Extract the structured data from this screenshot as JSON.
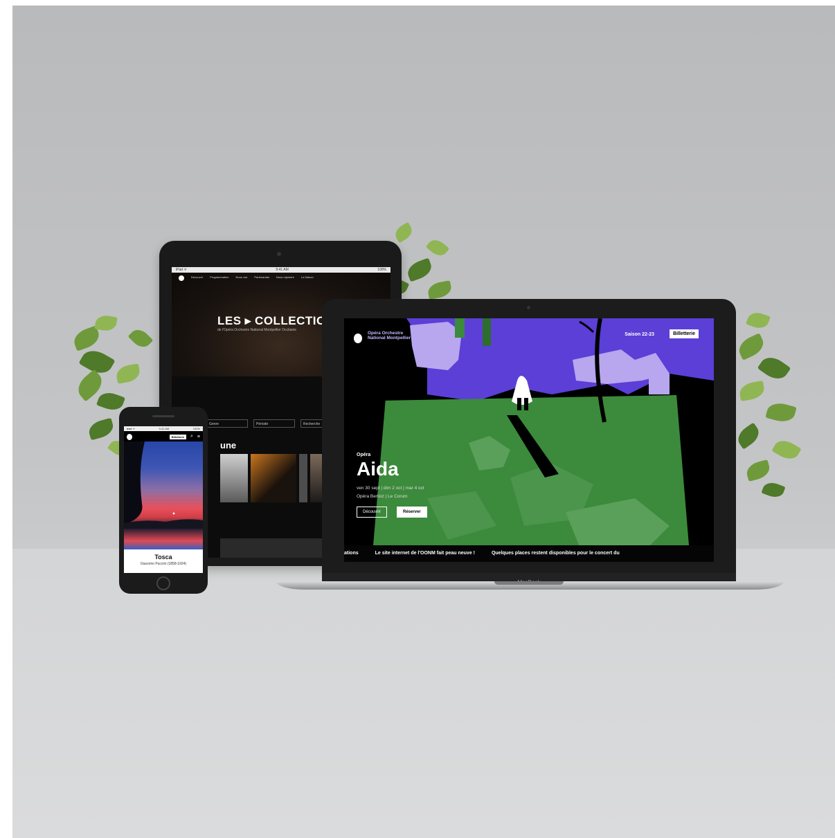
{
  "tablet": {
    "status_left": "iPad ᯤ",
    "status_time": "9:41 AM",
    "status_right": "100%",
    "nav_items": [
      "Découvrir",
      "Programmation",
      "Nous voir",
      "Partenariats",
      "Nous rejoindre",
      "La Saison"
    ],
    "hero_title": "LES ▸ COLLECTION",
    "hero_subtitle": "de l'Opéra Orchestre National Montpellier Occitanie",
    "filters": [
      "Genre",
      "Période",
      "Recherche"
    ],
    "section_title": "une"
  },
  "laptop": {
    "brand_name": "Opéra Orchestre National Montpellier",
    "season": "Saison 22-23",
    "tickets_button": "Billetterie",
    "category": "Opéra",
    "title": "Aida",
    "dates": "ven 30 sept | dim 2 oct | mar 4 oct",
    "venue": "Opéra Berlioz | Le Corum",
    "btn_discover": "Découvrir",
    "btn_book": "Réserver",
    "ticker": [
      "ations",
      "Le site internet de l'OONM fait peau neuve !",
      "Quelques places restent disponibles pour le concert du"
    ],
    "device_label": "MacBook"
  },
  "phone": {
    "status_left": "●●● ᯤ",
    "status_time": "9:41 AM",
    "status_right": "100%",
    "tickets_button": "Billetterie",
    "show_title": "Tosca",
    "show_subtitle": "Giacomo Puccini (1858-1924)"
  },
  "colors": {
    "background": "#c4c5c7",
    "floor": "#d6d7d8",
    "laptop_green": "#3c8a3c",
    "laptop_purple": "#5b3fd6",
    "laptop_lilac": "#b8a6ef"
  }
}
